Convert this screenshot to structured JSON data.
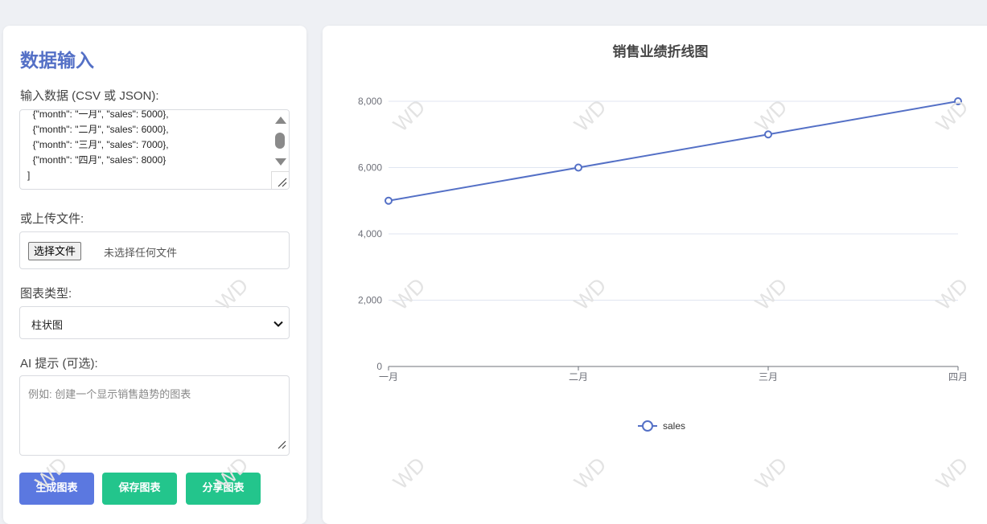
{
  "input_panel": {
    "title": "数据输入",
    "data_label": "输入数据 (CSV 或 JSON):",
    "data_lines": [
      "  {\"month\": \"一月\", \"sales\": 5000},",
      "  {\"month\": \"二月\", \"sales\": 6000},",
      "  {\"month\": \"三月\", \"sales\": 7000},",
      "  {\"month\": \"四月\", \"sales\": 8000}",
      "]"
    ],
    "upload_label": "或上传文件:",
    "file_button": "选择文件",
    "file_status": "未选择任何文件",
    "chart_type_label": "图表类型:",
    "chart_type_value": "柱状图",
    "prompt_label": "AI 提示 (可选):",
    "prompt_placeholder": "例如: 创建一个显示销售趋势的图表",
    "buttons": {
      "generate": "生成图表",
      "save": "保存图表",
      "share": "分享图表"
    },
    "colors": {
      "title": "#5470c6",
      "primary_button": "#5b78e0",
      "secondary_button": "#23c58c"
    }
  },
  "watermark_text": "WD",
  "chart_data": {
    "type": "line",
    "title": "销售业绩折线图",
    "categories": [
      "一月",
      "二月",
      "三月",
      "四月"
    ],
    "series": [
      {
        "name": "sales",
        "values": [
          5000,
          6000,
          7000,
          8000
        ],
        "color": "#5470c6"
      }
    ],
    "ylim": [
      0,
      8000
    ],
    "yticks": [
      "0",
      "2,000",
      "4,000",
      "6,000",
      "8,000"
    ],
    "ytick_values": [
      0,
      2000,
      4000,
      6000,
      8000
    ],
    "grid": true,
    "legend": "bottom-center"
  }
}
